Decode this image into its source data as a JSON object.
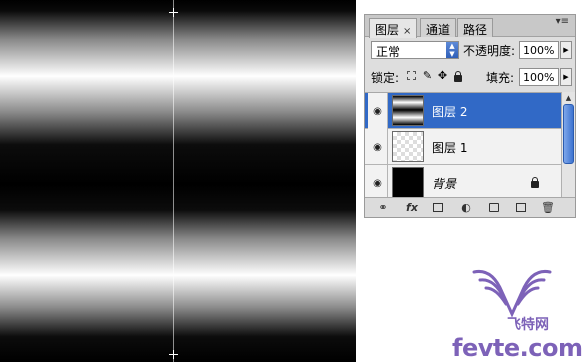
{
  "panel": {
    "tabs": [
      {
        "label": "图层",
        "close": "×"
      },
      {
        "label": "通道"
      },
      {
        "label": "路径"
      }
    ],
    "menu_glyph": "▾≡",
    "blend_mode": "正常",
    "opacity_label": "不透明度:",
    "opacity_value": "100%",
    "lock_label": "锁定:",
    "fill_label": "填充:",
    "fill_value": "100%",
    "layers": [
      {
        "name": "图层 2",
        "selected": true
      },
      {
        "name": "图层 1",
        "selected": false
      },
      {
        "name": "背景",
        "selected": false,
        "locked": true
      }
    ],
    "bottom_icons": [
      "link-icon",
      "fx-icon",
      "mask-icon",
      "adjustment-icon",
      "group-folder-icon",
      "new-layer-icon",
      "trash-icon"
    ],
    "fx_label": "fx"
  },
  "watermark": {
    "site": "fevte.com",
    "brand": "飞特网"
  },
  "colors": {
    "selection": "#3169c6",
    "watermark": "#7d62b8"
  }
}
